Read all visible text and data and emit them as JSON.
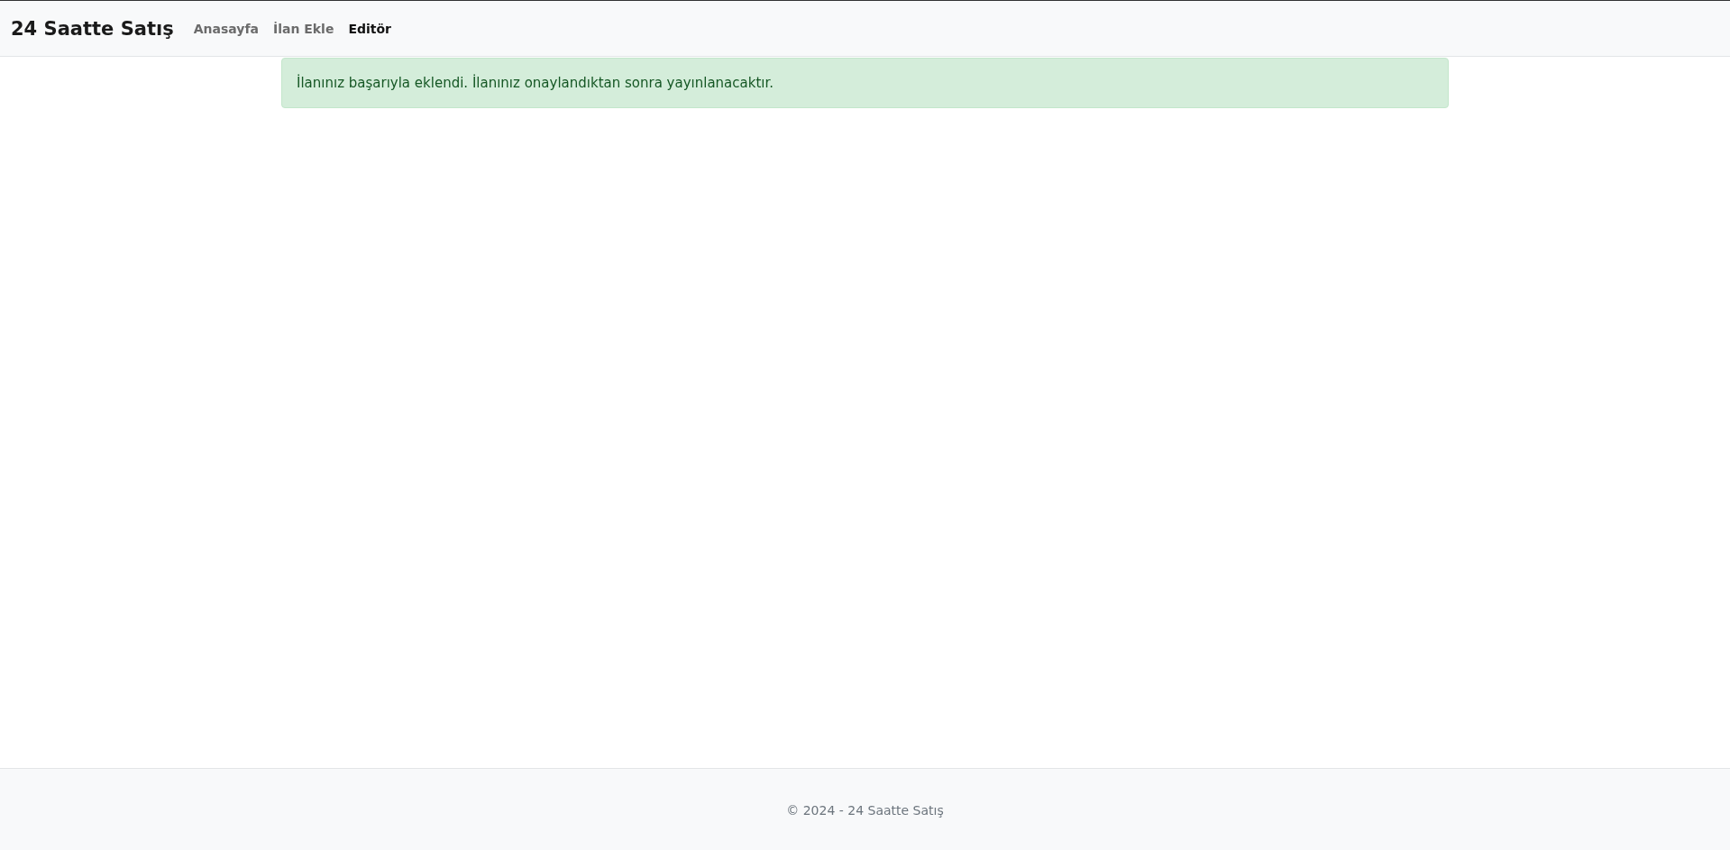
{
  "navbar": {
    "brand": "24 Saatte Satış",
    "links": [
      {
        "label": "Anasayfa",
        "selected": false
      },
      {
        "label": "İlan Ekle",
        "selected": false
      },
      {
        "label": "Editör",
        "selected": true
      }
    ]
  },
  "alert": {
    "kind": "success",
    "message": "İlanınız başarıyla eklendi. İlanınız onaylandıktan sonra yayınlanacaktır."
  },
  "footer": {
    "text": "© 2024 - 24 Saatte Satış"
  }
}
